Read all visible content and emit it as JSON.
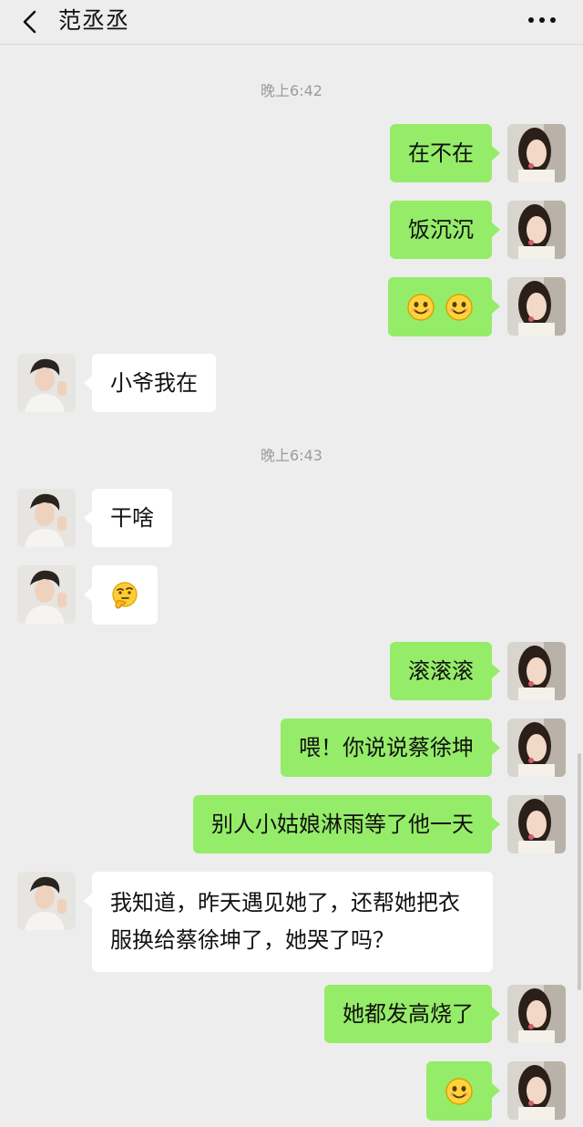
{
  "header": {
    "back_icon": "chevron-left-icon",
    "title": "范丞丞",
    "more_icon": "more-dots-icon"
  },
  "timestamps": [
    "晚上6:42",
    "晚上6:43"
  ],
  "messages": [
    {
      "dir": "out",
      "text": "在不在"
    },
    {
      "dir": "out",
      "text": "饭沉沉"
    },
    {
      "dir": "out",
      "emoji": [
        "smile-icon",
        "smile-icon"
      ]
    },
    {
      "dir": "in",
      "text": "小爷我在"
    },
    {
      "dir": "in",
      "text": "干啥"
    },
    {
      "dir": "in",
      "emoji": [
        "thinking-face-icon"
      ]
    },
    {
      "dir": "out",
      "text": "滚滚滚"
    },
    {
      "dir": "out",
      "text": "喂！你说说蔡徐坤"
    },
    {
      "dir": "out",
      "text": "别人小姑娘淋雨等了他一天"
    },
    {
      "dir": "in",
      "text": "我知道，昨天遇见她了，还帮她把衣服换给蔡徐坤了，她哭了吗？"
    },
    {
      "dir": "out",
      "text": "她都发高烧了"
    },
    {
      "dir": "out",
      "emoji": [
        "smile-icon"
      ]
    }
  ],
  "colors": {
    "background": "#ededed",
    "outgoing_bubble": "#95ec69",
    "incoming_bubble": "#ffffff"
  }
}
